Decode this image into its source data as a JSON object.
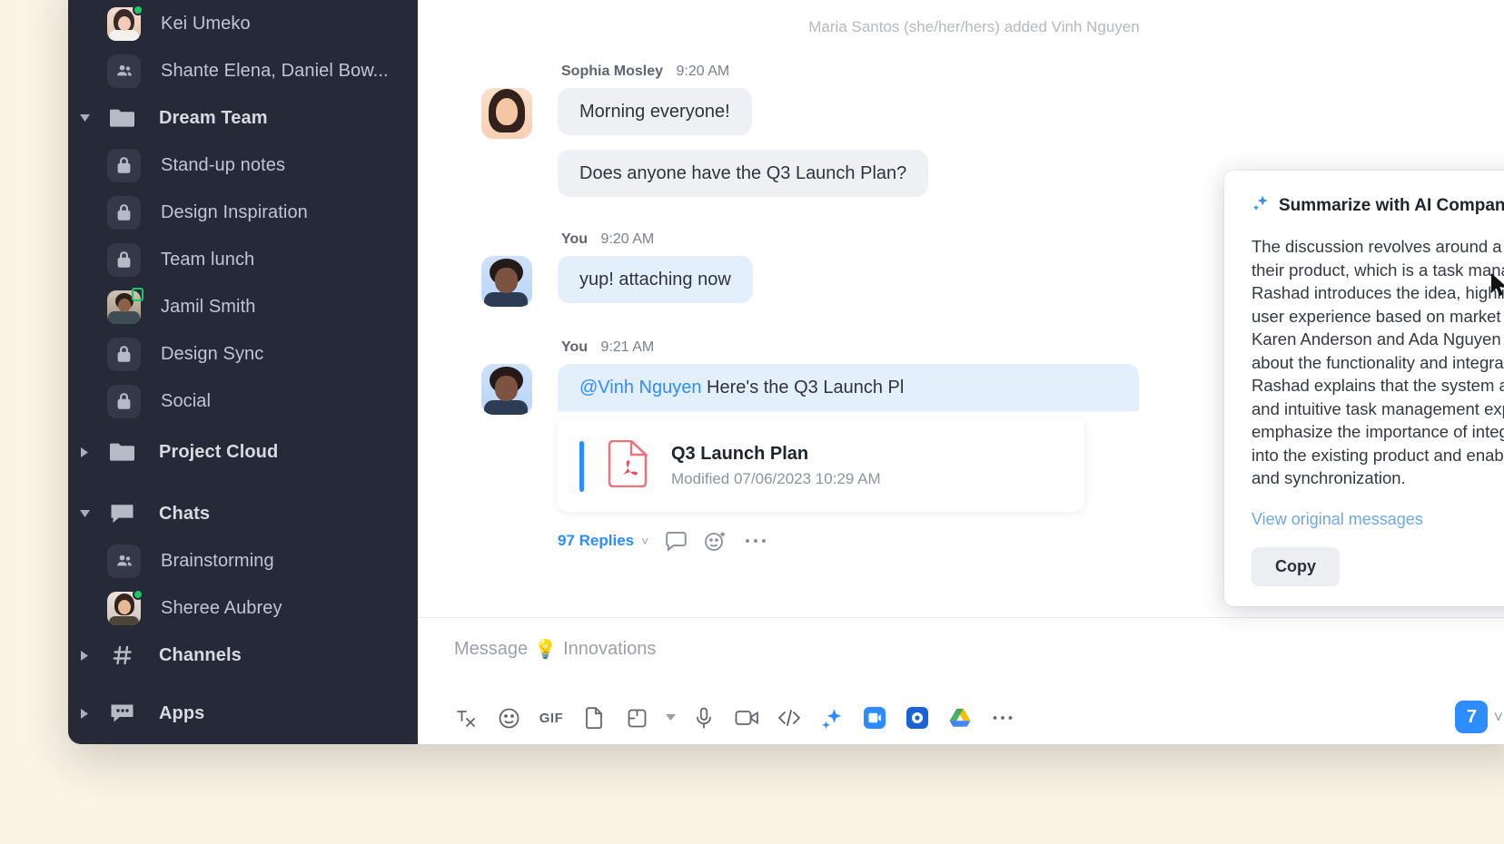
{
  "sidebar": {
    "items": [
      {
        "label": "Kei Umeko",
        "icon": "avatar-kei",
        "type": "contact",
        "presence": "available",
        "bold": false
      },
      {
        "label": "Shante Elena, Daniel Bow...",
        "icon": "group-icon",
        "type": "group",
        "bold": false
      },
      {
        "label": "Dream Team",
        "icon": "folder-icon",
        "type": "folder",
        "expanded": true,
        "bold": true
      },
      {
        "label": "Stand-up notes",
        "icon": "lock-icon",
        "type": "private-channel",
        "bold": false
      },
      {
        "label": "Design Inspiration",
        "icon": "lock-icon",
        "type": "private-channel",
        "bold": false
      },
      {
        "label": "Team lunch",
        "icon": "lock-icon",
        "type": "private-channel",
        "bold": false
      },
      {
        "label": "Jamil Smith",
        "icon": "avatar-jamil",
        "type": "contact",
        "presence": "mobile",
        "bold": false
      },
      {
        "label": "Design Sync",
        "icon": "lock-icon",
        "type": "private-channel",
        "bold": false
      },
      {
        "label": "Social",
        "icon": "lock-icon",
        "type": "private-channel",
        "bold": false
      },
      {
        "label": "Project Cloud",
        "icon": "folder-icon",
        "type": "folder",
        "expanded": false,
        "bold": true
      },
      {
        "label": "Chats",
        "icon": "chat-icon",
        "type": "section",
        "expanded": true,
        "bold": true
      },
      {
        "label": "Brainstorming",
        "icon": "group-icon",
        "type": "group",
        "bold": false
      },
      {
        "label": "Sheree Aubrey",
        "icon": "avatar-sheree",
        "type": "contact",
        "presence": "available",
        "bold": false
      },
      {
        "label": "Channels",
        "icon": "hash-icon",
        "type": "section",
        "expanded": false,
        "bold": true
      },
      {
        "label": "Apps",
        "icon": "apps-icon",
        "type": "section",
        "expanded": false,
        "bold": true
      }
    ]
  },
  "main": {
    "system_message": "Maria Santos (she/her/hers) added Vinh Nguyen",
    "messages": [
      {
        "author": "Sophia Mosley",
        "time": "9:20 AM",
        "avatar": "avatar-sophia",
        "text": "Morning everyone!",
        "second_text": "Does anyone have the Q3 Launch Plan?",
        "self": false
      },
      {
        "author": "You",
        "time": "9:20 AM",
        "avatar": "avatar-you",
        "text": "yup! attaching now",
        "self": true
      },
      {
        "author": "You",
        "time": "9:21 AM",
        "avatar": "avatar-you",
        "mention": "@Vinh Nguyen",
        "text": " Here's the Q3 Launch Pl",
        "self": true
      }
    ],
    "attachment": {
      "title": "Q3 Launch Plan",
      "subtitle": "Modified 07/06/2023 10:29 AM",
      "file_type": "pdf"
    },
    "thread": {
      "replies_label": "97 Replies",
      "chevron": "˅"
    }
  },
  "composer": {
    "placeholder_prefix": "Message",
    "placeholder_emoji": "💡",
    "placeholder_channel": "Innovations",
    "toolbar_icons": [
      "format-text-icon",
      "emoji-icon",
      "gif-icon",
      "file-icon",
      "screenshot-icon",
      "chevron-down-icon",
      "audio-message-icon",
      "video-message-icon",
      "code-snippet-icon",
      "ai-sparkle-icon",
      "zoom-meeting-icon",
      "zoom-whiteboard-icon",
      "drive-icon",
      "more-icon"
    ],
    "send_badge": "7",
    "send_chevron": "˅"
  },
  "ai_panel": {
    "title": "Summarize with AI Companion",
    "sparkle_color": "#2d8cff",
    "summary": "The discussion revolves around a proposed new feature for their product, which is a task management system. Nabil Rashad introduces the idea, highlighting the goal of improving user experience based on market research and user feedback. Karen Anderson and Ada Nguyen express interest and inquire about the functionality and integration of the system. Nabil Rashad explains that the system aims to provide a seamless and intuitive task management experience. They also emphasize the importance of integrating the system smoothly into the existing product and enabling cross-platform access and synchronization.",
    "link_label": "View original messages",
    "copy_label": "Copy",
    "close_label": "×",
    "thumbs_up": "thumbs-up-icon",
    "thumbs_down": "thumbs-down-icon"
  },
  "colors": {
    "sidebar_bg": "#262938",
    "page_bg": "#faf3e6",
    "accent_blue": "#2d8cff",
    "presence_green": "#18c964",
    "bubble_gray": "#eef0f4",
    "bubble_blue": "#e4effc"
  }
}
